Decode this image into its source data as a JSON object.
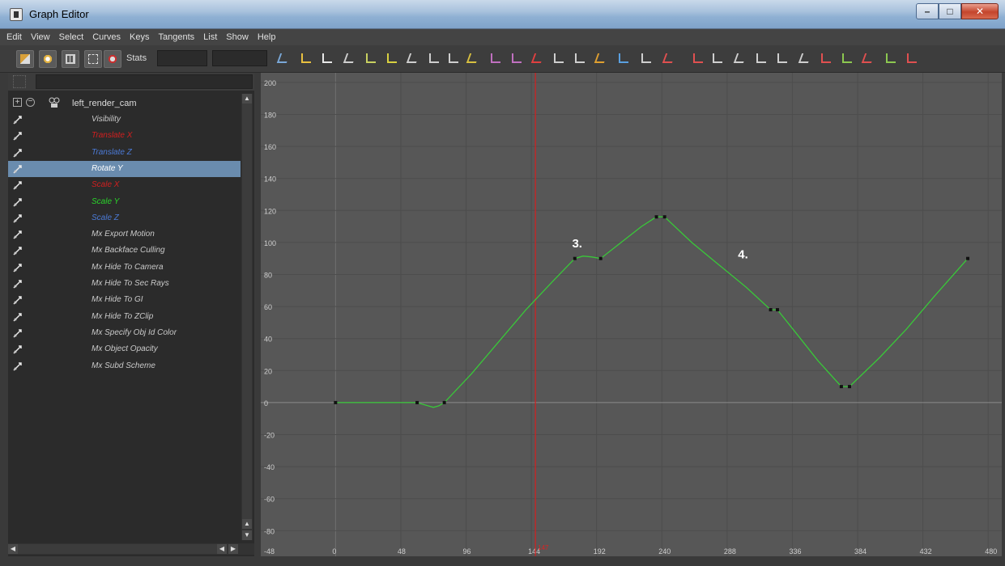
{
  "window": {
    "title": "Graph Editor",
    "min_glyph": "–",
    "max_glyph": "□",
    "close_glyph": "✕"
  },
  "menu": [
    "Edit",
    "View",
    "Select",
    "Curves",
    "Keys",
    "Tangents",
    "List",
    "Show",
    "Help"
  ],
  "toolbar": {
    "stats_label": "Stats",
    "stats_value_1": "",
    "stats_value_2": ""
  },
  "outliner": {
    "filter_text": "",
    "root": {
      "name": "left_render_cam",
      "expand_glyph": "+",
      "collapse_glyph": "−"
    },
    "attributes": [
      {
        "label": "Visibility",
        "color": "#c9c9c9"
      },
      {
        "label": "Translate X",
        "color": "#d21f1f"
      },
      {
        "label": "Translate Z",
        "color": "#4b7ad6"
      },
      {
        "label": "Rotate Y",
        "color": "#ffffff",
        "selected": true
      },
      {
        "label": "Scale X",
        "color": "#d21f1f"
      },
      {
        "label": "Scale Y",
        "color": "#2bd42b"
      },
      {
        "label": "Scale Z",
        "color": "#4b7ad6"
      },
      {
        "label": "Mx Export Motion",
        "color": "#c9c9c9"
      },
      {
        "label": "Mx Backface Culling",
        "color": "#c9c9c9"
      },
      {
        "label": "Mx Hide To Camera",
        "color": "#c9c9c9"
      },
      {
        "label": "Mx Hide To Sec Rays",
        "color": "#c9c9c9"
      },
      {
        "label": "Mx Hide To GI",
        "color": "#c9c9c9"
      },
      {
        "label": "Mx Hide To ZClip",
        "color": "#c9c9c9"
      },
      {
        "label": "Mx Specify Obj Id Color",
        "color": "#c9c9c9"
      },
      {
        "label": "Mx Object Opacity",
        "color": "#c9c9c9"
      },
      {
        "label": "Mx Subd Scheme",
        "color": "#c9c9c9"
      }
    ]
  },
  "chart_data": {
    "type": "line",
    "x_ticks": [
      "0",
      "48",
      "96",
      "144",
      "192",
      "240",
      "288",
      "336",
      "384",
      "432",
      "480"
    ],
    "y_ticks": [
      "200",
      "180",
      "160",
      "140",
      "120",
      "100",
      "80",
      "60",
      "40",
      "20",
      "0",
      "-20",
      "-40",
      "-60",
      "-80",
      "-48"
    ],
    "xlim": [
      -55,
      490
    ],
    "ylim": [
      -96,
      206
    ],
    "current_time": 147,
    "current_time_label": "147",
    "series": [
      {
        "color": "#39c839",
        "keys": [
          {
            "x": 0,
            "y": 0
          },
          {
            "x": 60,
            "y": 0
          },
          {
            "x": 80,
            "y": 0
          },
          {
            "x": 176,
            "y": 90
          },
          {
            "x": 195,
            "y": 90
          },
          {
            "x": 236,
            "y": 116
          },
          {
            "x": 242,
            "y": 116
          },
          {
            "x": 320,
            "y": 58
          },
          {
            "x": 325,
            "y": 58
          },
          {
            "x": 372,
            "y": 10
          },
          {
            "x": 378,
            "y": 10
          },
          {
            "x": 465,
            "y": 90
          }
        ],
        "curve": [
          [
            0,
            0
          ],
          [
            60,
            0
          ],
          [
            64,
            -1
          ],
          [
            68,
            -2
          ],
          [
            72,
            -3
          ],
          [
            76,
            -2
          ],
          [
            80,
            0
          ],
          [
            100,
            18
          ],
          [
            120,
            38
          ],
          [
            140,
            58
          ],
          [
            160,
            76
          ],
          [
            176,
            90
          ],
          [
            182,
            91.5
          ],
          [
            188,
            91
          ],
          [
            195,
            90
          ],
          [
            210,
            100
          ],
          [
            225,
            110
          ],
          [
            236,
            116
          ],
          [
            242,
            116
          ],
          [
            262,
            100
          ],
          [
            282,
            86
          ],
          [
            302,
            72
          ],
          [
            320,
            58
          ],
          [
            325,
            58
          ],
          [
            340,
            42
          ],
          [
            355,
            26
          ],
          [
            372,
            10
          ],
          [
            378,
            10
          ],
          [
            400,
            28
          ],
          [
            420,
            46
          ],
          [
            440,
            66
          ],
          [
            465,
            90
          ]
        ]
      }
    ],
    "annotations": [
      {
        "text": "3.",
        "x": 174,
        "y": 97
      },
      {
        "text": "4.",
        "x": 296,
        "y": 90
      }
    ]
  }
}
